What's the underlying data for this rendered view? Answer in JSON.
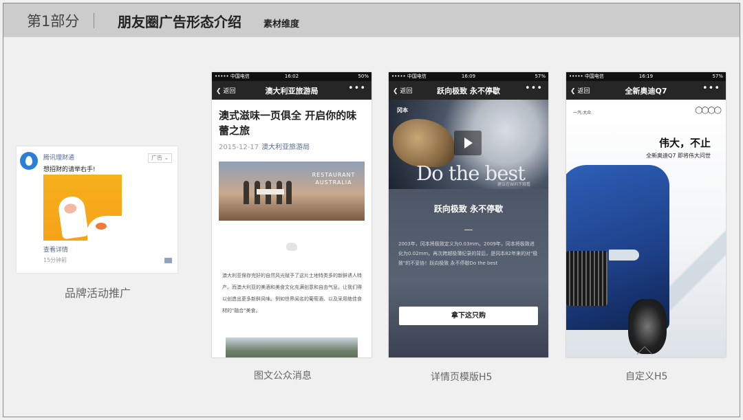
{
  "header": {
    "part": "第1部分",
    "title": "朋友圈广告形态介绍",
    "subtitle": "素材维度"
  },
  "cards": [
    {
      "caption": "品牌活动推广",
      "account": "腾讯理财通",
      "text": "想招财的请举右手!",
      "badge": "广告",
      "more": "查看详情",
      "time": "15分钟前"
    },
    {
      "caption": "图文公众消息",
      "status": {
        "carrier": "••••• 中国电信 ",
        "time": "16:02",
        "battery": "50%"
      },
      "nav": {
        "back": "返回",
        "title": "澳大利亚旅游局",
        "dots": "•••"
      },
      "article_title": "澳式滋味一页俱全  开启你的味蕾之旅",
      "date": "2015-12-17",
      "account": "澳大利亚旅游局",
      "image_text": "RESTAURANT AUSTRALIA",
      "body": "澳大利亚保存完好的自然风光赋予了这片土地特类多的新鲜诱人特产。而澳大利亚的美酒和美食文化充满创意和自由气息。让我们得以创造出更多新鲜风味。例如世界闻名的葡萄酒、以及采用绝佳食材的\"融合\"美食。"
    },
    {
      "caption": "详情页模版H5",
      "status": {
        "carrier": "••••• 中国电信 ",
        "time": "16:09",
        "battery": "57%"
      },
      "nav": {
        "back": "返回",
        "title": "跃向极致 永不停歇",
        "dots": "•••"
      },
      "brand": "冈本",
      "hero_text": "Do the best",
      "wifi_note": "建议在WiFi下观看",
      "heading": "跃向极致 永不停歇",
      "body": "2003年，冈本将极致定义为0.03mm。2009年，冈本将极致进化为0.02mm。再次跨越极薄纪录的背后，是冈本82年来的对\"极致\"的不妥协！跃向极致 永不停歇Do the best",
      "button": "拿下这只购"
    },
    {
      "caption": "自定义H5",
      "status": {
        "carrier": "••••• 中国电信 ",
        "time": "16:19",
        "battery": "57%"
      },
      "nav": {
        "back": "返回",
        "title": "全新奥迪Q7",
        "dots": "•••"
      },
      "logo_text": "一汽-大众",
      "slogan": "伟大，不止",
      "slogan2": "全新奥迪Q7 即将伟大问世"
    }
  ]
}
